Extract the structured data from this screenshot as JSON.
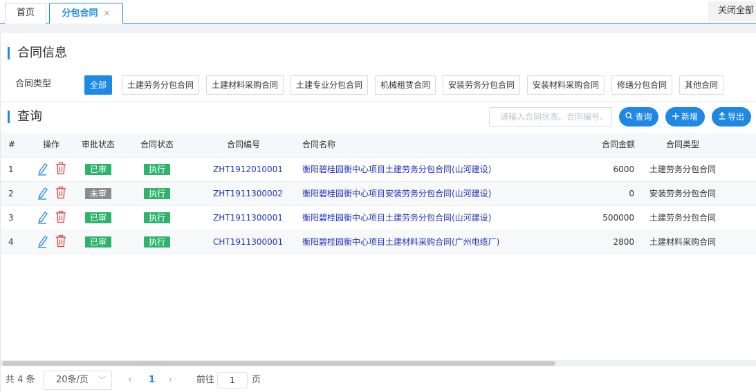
{
  "tabs": {
    "home": "首页",
    "active": "分包合同",
    "close": "×",
    "close_all": "关闭全部"
  },
  "info": {
    "title": "合同信息",
    "type_label": "合同类型",
    "types": [
      "全部",
      "土建劳务分包合同",
      "土建材料采购合同",
      "土建专业分包合同",
      "机械租赁合同",
      "安装劳务分包合同",
      "安装材料采购合同",
      "修缮分包合同",
      "其他合同"
    ],
    "selected": "全部"
  },
  "query": {
    "title": "查询",
    "search_placeholder": "请输入合同状态、合同编号、",
    "search_btn": "查询",
    "add_btn": "新增",
    "export_btn": "导出"
  },
  "table": {
    "headers": [
      "#",
      "操作",
      "审批状态",
      "合同状态",
      "合同编号",
      "合同名称",
      "合同金额",
      "合同类型"
    ],
    "rows": [
      {
        "no": "1",
        "approval": "已审",
        "approval_color": "#2eb36b",
        "status": "执行",
        "code": "ZHT1912010001",
        "name": "衡阳碧桂园衡中心项目土建劳务分包合同(山河建设)",
        "amount": "6000",
        "type": "土建劳务分包合同"
      },
      {
        "no": "2",
        "approval": "未审",
        "approval_color": "#8c8c8c",
        "status": "执行",
        "code": "ZHT1911300002",
        "name": "衡阳碧桂园衡中心项目安装劳务分包合同(山河建设)",
        "amount": "0",
        "type": "安装劳务分包合同"
      },
      {
        "no": "3",
        "approval": "已审",
        "approval_color": "#2eb36b",
        "status": "执行",
        "code": "ZHT1911300001",
        "name": "衡阳碧桂园衡中心项目土建劳务分包合同(山河建设)",
        "amount": "500000",
        "type": "土建劳务分包合同"
      },
      {
        "no": "4",
        "approval": "已审",
        "approval_color": "#2eb36b",
        "status": "执行",
        "code": "CHT1911300001",
        "name": "衡阳碧桂园衡中心项目土建材料采购合同(广州电缆厂)",
        "amount": "2800",
        "type": "土建材料采购合同"
      }
    ]
  },
  "pager": {
    "total": "共 4 条",
    "size": "20条/页",
    "prev": "‹",
    "current": "1",
    "next": "›",
    "goto_label": "前往",
    "goto_value": "1",
    "page_suffix": "页"
  },
  "colors": {
    "accent": "#1e88e5",
    "approved": "#2eb36b",
    "pending": "#8c8c8c",
    "link": "#2233bb",
    "delete": "#e53935"
  }
}
